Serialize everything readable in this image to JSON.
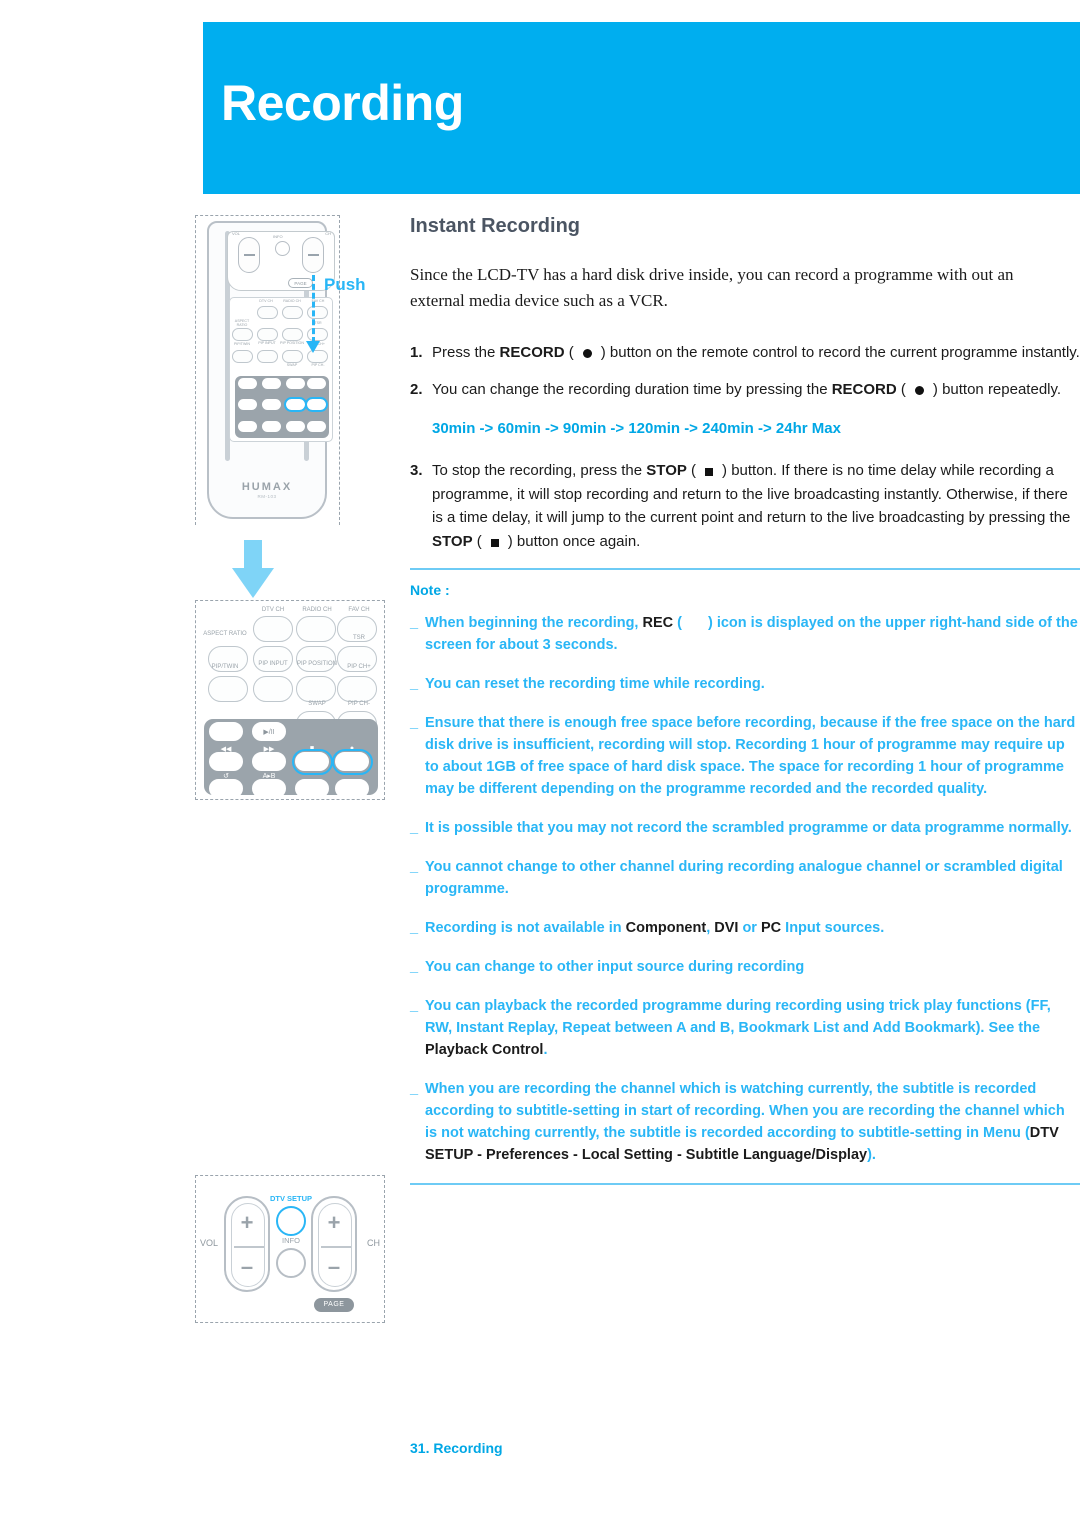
{
  "colors": {
    "cyan": "#00AEEF",
    "cyan_light": "#29B6F6",
    "rule": "#6ECBF5",
    "heading_gray": "#4B5563"
  },
  "header": {
    "title": "Recording"
  },
  "content": {
    "section_title": "Instant Recording",
    "intro": "Since the LCD-TV has a hard disk drive inside, you can record a programme with out an external media device such as a VCR.",
    "steps": [
      {
        "num": "1.",
        "parts": [
          {
            "t": "Press the ",
            "style": "normal"
          },
          {
            "t": "RECORD",
            "style": "bold"
          },
          {
            "t": " (",
            "style": "normal"
          },
          {
            "t": "",
            "style": "icon-rec"
          },
          {
            "t": ") button on the remote control to record the current programme instantly.",
            "style": "normal"
          }
        ]
      },
      {
        "num": "2.",
        "parts": [
          {
            "t": "You can change the recording duration time by pressing the ",
            "style": "normal"
          },
          {
            "t": "RECORD",
            "style": "bold"
          },
          {
            "t": " (",
            "style": "normal"
          },
          {
            "t": "",
            "style": "icon-rec"
          },
          {
            "t": ") button repeatedly.",
            "style": "normal"
          }
        ]
      },
      {
        "num": "3.",
        "parts": [
          {
            "t": "To stop the recording, press the ",
            "style": "normal"
          },
          {
            "t": "STOP",
            "style": "bold"
          },
          {
            "t": " (",
            "style": "normal"
          },
          {
            "t": "",
            "style": "icon-stop"
          },
          {
            "t": ") button. If there is no time delay while recording a programme, it will stop recording and return to the live broadcasting instantly. Otherwise, if there is a time delay, it will jump to the current point and return to the live broadcasting by pressing the ",
            "style": "normal"
          },
          {
            "t": "STOP",
            "style": "bold"
          },
          {
            "t": " (",
            "style": "normal"
          },
          {
            "t": "",
            "style": "icon-stop"
          },
          {
            "t": ") button once again.",
            "style": "normal"
          }
        ]
      }
    ],
    "duration_sequence": "30min -> 60min -> 90min -> 120min -> 240min -> 24hr Max",
    "note_label": "Note :",
    "notes": [
      {
        "marker": "_",
        "parts": [
          {
            "t": "When beginning the recording, ",
            "style": "cyan"
          },
          {
            "t": "REC",
            "style": "black"
          },
          {
            "t": " (",
            "style": "cyan"
          },
          {
            "t": "",
            "style": "icon-blank"
          },
          {
            "t": ") icon is displayed on the upper right-hand side of the screen for about 3 seconds.",
            "style": "cyan"
          }
        ]
      },
      {
        "marker": "_",
        "parts": [
          {
            "t": "You can reset the recording time while recording.",
            "style": "cyan"
          }
        ]
      },
      {
        "marker": "_",
        "parts": [
          {
            "t": "Ensure that there is enough free space before recording, because if the free space on the hard disk drive is insufficient, recording will stop. Recording 1 hour of programme may require up to about 1GB of free space of hard disk space. The space for recording 1 hour of programme may be different depending on the programme recorded and the recorded quality.",
            "style": "cyan"
          }
        ]
      },
      {
        "marker": "_",
        "parts": [
          {
            "t": "It is possible that you may not record the scrambled programme or data programme normally.",
            "style": "cyan"
          }
        ]
      },
      {
        "marker": "_",
        "parts": [
          {
            "t": "You cannot change to other channel during recording analogue channel or scrambled digital programme.",
            "style": "cyan"
          }
        ]
      },
      {
        "marker": "_",
        "parts": [
          {
            "t": "Recording is not available in ",
            "style": "cyan"
          },
          {
            "t": "Component",
            "style": "black"
          },
          {
            "t": ", ",
            "style": "cyan"
          },
          {
            "t": "DVI",
            "style": "black"
          },
          {
            "t": " or ",
            "style": "cyan"
          },
          {
            "t": "PC",
            "style": "black"
          },
          {
            "t": " Input sources.",
            "style": "cyan"
          }
        ]
      },
      {
        "marker": "_",
        "parts": [
          {
            "t": "You can change to other input source during recording",
            "style": "cyan"
          }
        ]
      },
      {
        "marker": "_",
        "parts": [
          {
            "t": "You can playback the recorded programme during recording using trick play functions (FF, RW, Instant Replay, Repeat between A and B, Bookmark List and Add Bookmark). See the ",
            "style": "cyan"
          },
          {
            "t": "Playback Control",
            "style": "black"
          },
          {
            "t": ".",
            "style": "cyan"
          }
        ]
      },
      {
        "marker": "_",
        "parts": [
          {
            "t": "When you are recording the channel which is watching currently, the subtitle is recorded according to subtitle-setting in start of recording. When you are recording the channel which is not watching currently, the subtitle is recorded according to subtitle-setting in Menu ",
            "style": "cyan"
          },
          {
            "t": "(",
            "style": "cyan"
          },
          {
            "t": "DTV SETUP - Preferences - Local Setting - Subtitle Language/Display",
            "style": "black"
          },
          {
            "t": ").",
            "style": "cyan"
          }
        ]
      }
    ]
  },
  "illustrations": {
    "remote": {
      "brand": "HUMAX",
      "model": "RM-103",
      "top_labels": {
        "vol": "VOL",
        "ch": "CH",
        "info": "INFO",
        "page": "PAGE"
      },
      "push_label": "Push",
      "keypad_labels": [
        "DTV CH",
        "RADIO CH",
        "FAV CH",
        "ASPECT RATIO",
        "TSR",
        "PIP/TWIN",
        "PIP INPUT",
        "PIP POSITION",
        "PIP CH+",
        "SWAP",
        "PIP CH-"
      ]
    },
    "keypad_zoom": {
      "row1": [
        "DTV CH",
        "RADIO CH",
        "FAV CH"
      ],
      "aspect": "ASPECT RATIO",
      "tsr": "TSR",
      "pip_twin": "PIP/TWIN",
      "pip_input": "PIP INPUT",
      "pip_position": "PIP POSITION",
      "pip_ch_plus": "PIP CH+",
      "swap": "SWAP",
      "pip_ch_minus": "PIP CH-",
      "play_pause": "▶/II",
      "rew": "◀◀",
      "ff": "▶▶",
      "stop_mark": "■",
      "rec_mark": "●",
      "repeat": "↺",
      "ab": "A▸B"
    },
    "volch_zoom": {
      "vol": "VOL",
      "ch": "CH",
      "dtv_setup": "DTV SETUP",
      "info": "INFO",
      "page": "PAGE",
      "plus": "+",
      "minus": "–"
    }
  },
  "footer": {
    "page_label": "31. Recording"
  }
}
